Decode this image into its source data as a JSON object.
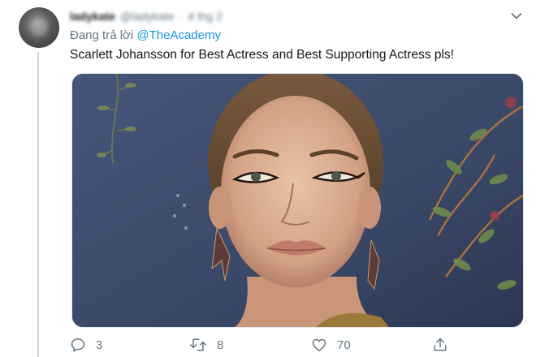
{
  "tweet": {
    "author_name": "ladykate",
    "author_handle": "@ladykate",
    "timestamp": "4 thg 2",
    "replying_prefix": "Đang trả lời",
    "replying_to": "@TheAcademy",
    "text": "Scarlett Johansson for Best Actress and Best Supporting Actress pls!"
  },
  "actions": {
    "reply_count": "3",
    "retweet_count": "8",
    "like_count": "70"
  },
  "colors": {
    "link": "#1b95e0",
    "muted": "#657786",
    "thread_line": "#ccd6dd"
  },
  "icons": [
    "chevron-down-icon",
    "reply-icon",
    "retweet-icon",
    "like-icon",
    "share-icon"
  ]
}
